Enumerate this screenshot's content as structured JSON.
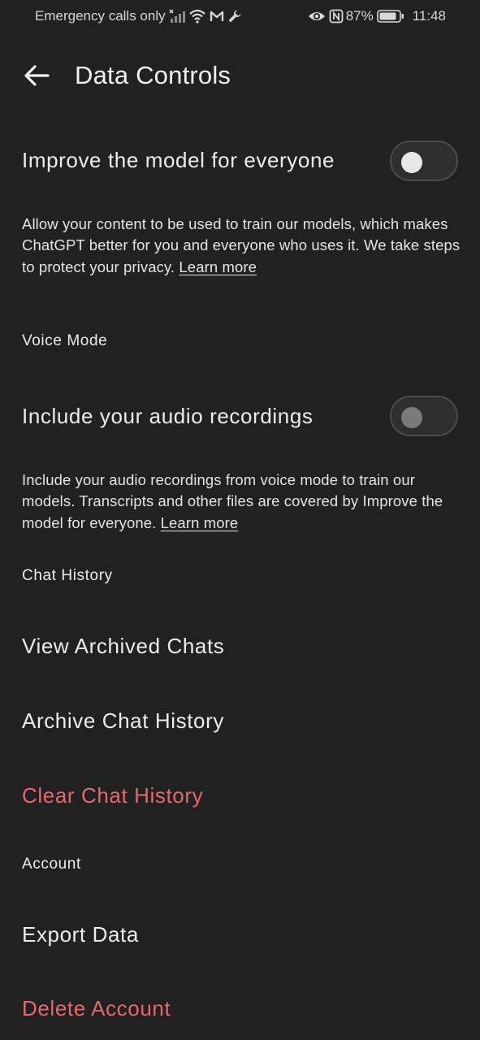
{
  "status_bar": {
    "carrier": "Emergency calls only",
    "battery": "87%",
    "time": "11:48"
  },
  "header": {
    "title": "Data Controls",
    "back_icon": "arrow-left-icon"
  },
  "improve_model": {
    "label": "Improve the model for everyone",
    "toggle_on": false,
    "description": "Allow your content to be used to train our models, which makes ChatGPT better for you and everyone who uses it. We take steps to protect your privacy.",
    "link": "Learn more"
  },
  "voice_mode": {
    "section": "Voice Mode",
    "label": "Include your audio recordings",
    "toggle_on": false,
    "description": "Include your audio recordings from voice mode to train our models. Transcripts and other files are covered by Improve the model for everyone.",
    "link": "Learn more"
  },
  "chat_history": {
    "section": "Chat History",
    "view_archived": "View Archived Chats",
    "archive_history": "Archive Chat History",
    "clear_history": "Clear Chat History"
  },
  "account": {
    "section": "Account",
    "export_data": "Export Data",
    "delete_account": "Delete Account"
  },
  "colors": {
    "background": "#212121",
    "text": "#ececec",
    "danger": "#e8676a"
  }
}
